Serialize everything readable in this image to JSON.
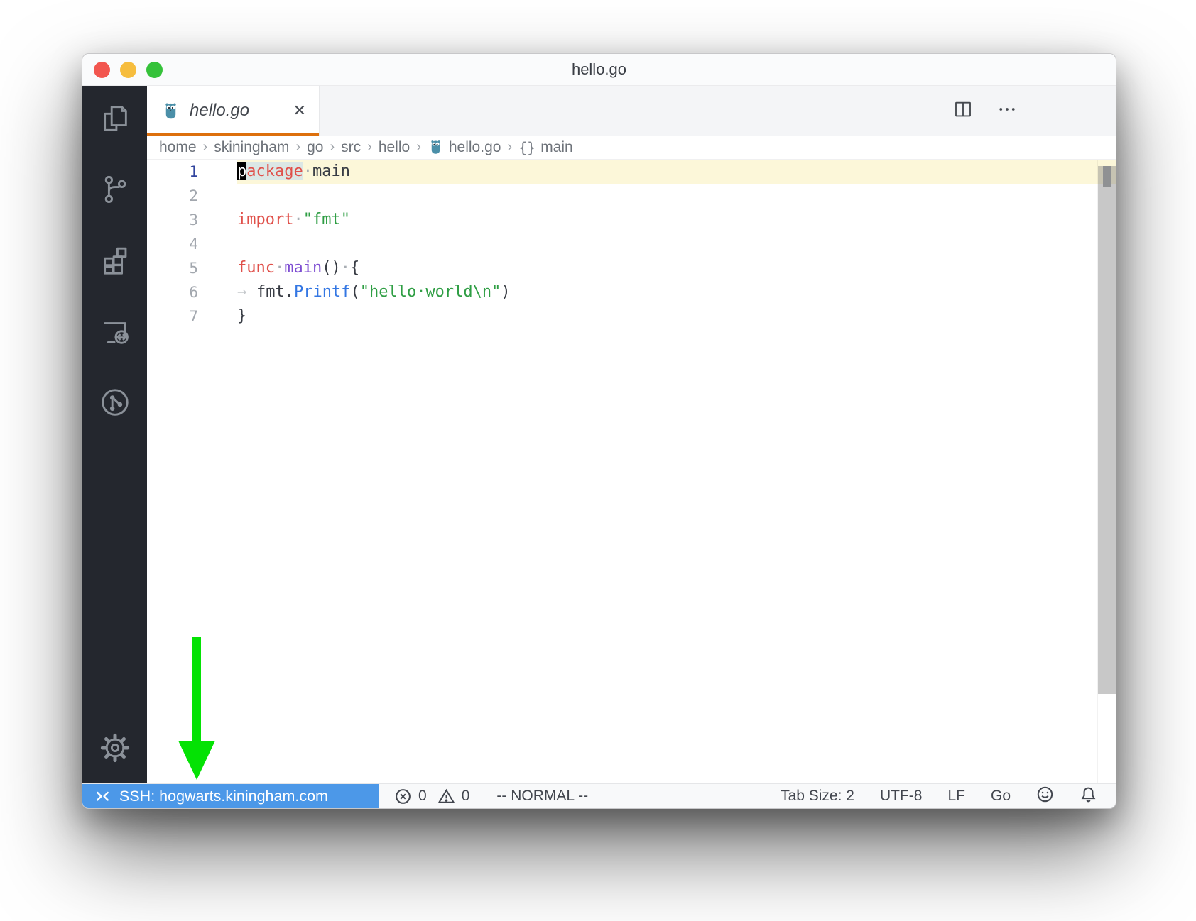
{
  "window_title": "hello.go",
  "window_controls": [
    "close",
    "minimize",
    "zoom"
  ],
  "activity_bar": {
    "items": [
      "explorer",
      "source-control",
      "extensions",
      "remote-explorer",
      "source-control-graph",
      "settings"
    ]
  },
  "tab": {
    "title": "hello.go",
    "file_icon": "go-gopher-icon",
    "close_glyph": "✕",
    "active": true
  },
  "editor_actions": [
    "split-editor",
    "more-actions"
  ],
  "breadcrumb": {
    "items": [
      {
        "label": "home"
      },
      {
        "label": "skiningham"
      },
      {
        "label": "go"
      },
      {
        "label": "src"
      },
      {
        "label": "hello"
      },
      {
        "label": "hello.go",
        "icon": "go-gopher-icon"
      },
      {
        "label": "main",
        "brackets": "{}"
      }
    ],
    "separator": "›"
  },
  "code": {
    "language": "go",
    "lines": [
      {
        "num": "1",
        "current": true,
        "tokens": [
          {
            "t": "p",
            "cls": "cursor"
          },
          {
            "t": "ackage",
            "cls": "kw wordhl"
          },
          {
            "t": "·",
            "cls": "ws"
          },
          {
            "t": "main",
            "cls": "txt"
          }
        ]
      },
      {
        "num": "2",
        "tokens": []
      },
      {
        "num": "3",
        "tokens": [
          {
            "t": "import",
            "cls": "kw"
          },
          {
            "t": "·",
            "cls": "ws"
          },
          {
            "t": "\"fmt\"",
            "cls": "str"
          }
        ]
      },
      {
        "num": "4",
        "tokens": []
      },
      {
        "num": "5",
        "tokens": [
          {
            "t": "func",
            "cls": "kw"
          },
          {
            "t": "·",
            "cls": "ws"
          },
          {
            "t": "main",
            "cls": "decl"
          },
          {
            "t": "()",
            "cls": "txt"
          },
          {
            "t": "·",
            "cls": "ws"
          },
          {
            "t": "{",
            "cls": "txt"
          }
        ]
      },
      {
        "num": "6",
        "tokens": [
          {
            "t": "→",
            "cls": "tabws"
          },
          {
            "t": "fmt.",
            "cls": "txt"
          },
          {
            "t": "Printf",
            "cls": "fn"
          },
          {
            "t": "(",
            "cls": "txt"
          },
          {
            "t": "\"hello·world\\n\"",
            "cls": "str"
          },
          {
            "t": ")",
            "cls": "txt"
          }
        ]
      },
      {
        "num": "7",
        "tokens": [
          {
            "t": "}",
            "cls": "txt"
          }
        ]
      }
    ]
  },
  "status_bar": {
    "remote": {
      "label": "SSH: hogwarts.kiningham.com",
      "icon": "remote-icon"
    },
    "problems": {
      "errors": "0",
      "warnings": "0"
    },
    "mode": "-- NORMAL --",
    "tab_size": "Tab Size: 2",
    "encoding": "UTF-8",
    "eol": "LF",
    "language": "Go",
    "right_icons": [
      "feedback-smiley-icon",
      "notifications-bell-icon"
    ]
  },
  "annotation": {
    "shape": "arrow-down",
    "color": "#04e204"
  },
  "colors": {
    "remote_bg": "#4c98e8",
    "tab_accent": "#dd700d",
    "activity_bar_bg": "#24272e",
    "current_line_bg": "#fcf7d9",
    "keyword": "#e0504a",
    "string": "#2f9e44",
    "function": "#3477e3",
    "declaration": "#7e4ed2",
    "annotation_green": "#04e204"
  }
}
